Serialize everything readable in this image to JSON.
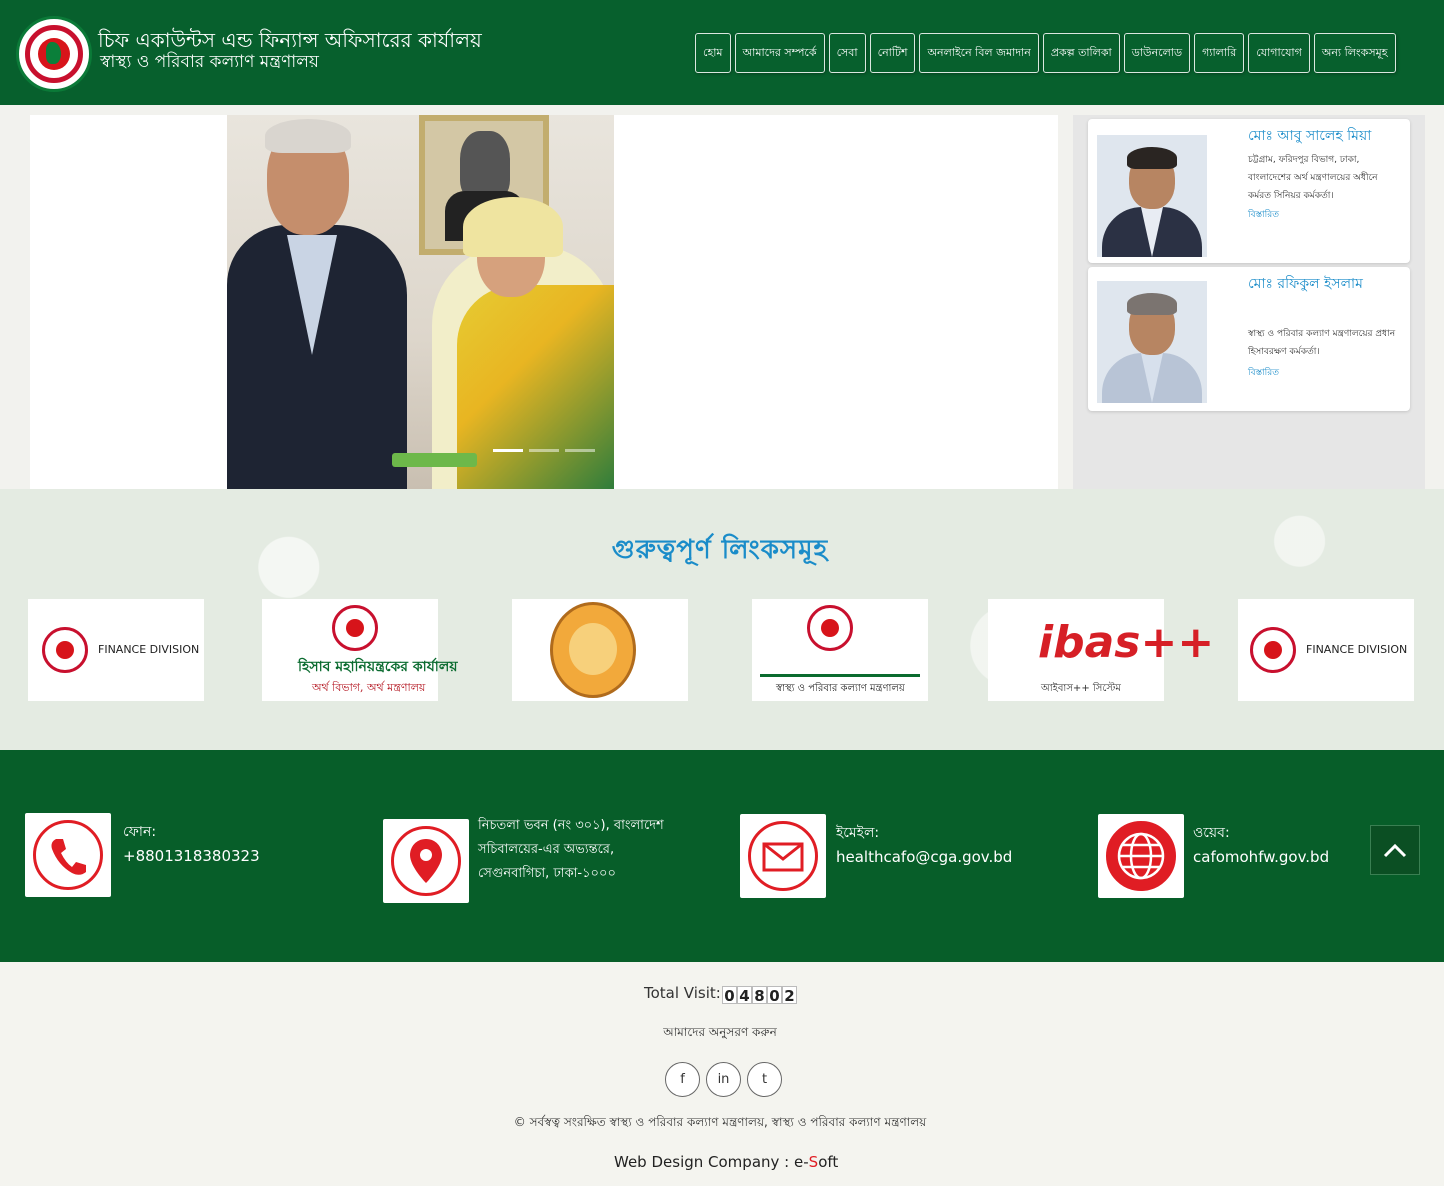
{
  "header": {
    "site_title": "চিফ একাউন্টস এন্ড ফিন্যান্স অফিসারের কার্যালয়",
    "site_subtitle": "স্বাস্থ্য ও পরিবার কল্যাণ মন্ত্রণালয়",
    "nav": [
      {
        "label": "হোম"
      },
      {
        "label": "আমাদের সম্পর্কে"
      },
      {
        "label": "সেবা"
      },
      {
        "label": "নোটিশ"
      },
      {
        "label": "অনলাইনে বিল জমাদান"
      },
      {
        "label": "প্রকল্প তালিকা"
      },
      {
        "label": "ডাউনলোড"
      },
      {
        "label": "গ্যালারি"
      },
      {
        "label": "যোগাযোগ"
      },
      {
        "label": "অন্য লিংকসমূহ"
      }
    ],
    "colors": {
      "brand_green": "#07602d",
      "accent_blue": "#1a8cc9",
      "accent_red": "#e01d24"
    }
  },
  "slider": {
    "prev_icon": "chevron-left-icon",
    "next_icon": "chevron-right-icon",
    "slide_count": 3,
    "active_slide": 1
  },
  "officers": [
    {
      "name": "মোঃ আবু সালেহ মিয়া",
      "description": "চট্টগ্রাম, ফরিদপুর বিভাগ, ঢাকা, বাংলাদেশের অর্থ মন্ত্রণালয়ের অধীনে কর্মরত সিনিয়র কর্মকর্তা।",
      "more": "বিস্তারিত"
    },
    {
      "name": "মোঃ রফিকুল ইসলাম",
      "description": "স্বাস্থ্য ও পরিবার কল্যাণ মন্ত্রণালয়ের প্রধান হিসাবরক্ষণ কর্মকর্তা।",
      "more": "বিস্তারিত"
    }
  ],
  "links": {
    "title": "গুরুত্বপূর্ণ লিংকসমূহ",
    "items": [
      {
        "name": "finance-division-logo",
        "text": "FINANCE DIVISION"
      },
      {
        "name": "cga-logo",
        "text": "হিসাব মহানিয়ন্ত্রকের কার্যালয়",
        "sub": "অর্থ বিভাগ, অর্থ মন্ত্রণালয়"
      },
      {
        "name": "cag-logo",
        "text": ""
      },
      {
        "name": "mohfw-logo",
        "text": "স্বাস্থ্য ও পরিবার কল্যাণ মন্ত্রণালয়"
      },
      {
        "name": "ibas-logo",
        "text": "ibas++",
        "sub": "আইবাস++ সিস্টেম"
      },
      {
        "name": "finance-division-logo-2",
        "text": "FINANCE DIVISION"
      }
    ]
  },
  "contact": {
    "phone": {
      "label": "ফোন:",
      "value": "+8801318380323"
    },
    "address": {
      "line1": "নিচতলা ভবন (নং ৩০১), বাংলাদেশ",
      "line2": "সচিবালয়ের-এর অভ্যন্তরে,",
      "line3": "সেগুনবাগিচা, ঢাকা-১০০০"
    },
    "email": {
      "label": "ইমেইল:",
      "value": "healthcafo@cga.gov.bd"
    },
    "web": {
      "label": "ওয়েব:",
      "value": "cafomohfw.gov.bd"
    }
  },
  "footer": {
    "visit_label": "Total Visit:",
    "visit_digits": [
      "0",
      "4",
      "8",
      "0",
      "2"
    ],
    "follow": "আমাদের অনুসরণ করুন",
    "socials": [
      "facebook-icon",
      "linkedin-icon",
      "twitter-icon"
    ],
    "copyright": "© সর্বস্বত্ব সংরক্ষিত স্বাস্থ্য ও পরিবার কল্যাণ মন্ত্রণালয়, স্বাস্থ্য ও পরিবার কল্যাণ মন্ত্রণালয়",
    "design_label": "Web Design Company :",
    "design_brand_pre": "e-",
    "design_brand_s": "S",
    "design_brand_post": "oft"
  }
}
